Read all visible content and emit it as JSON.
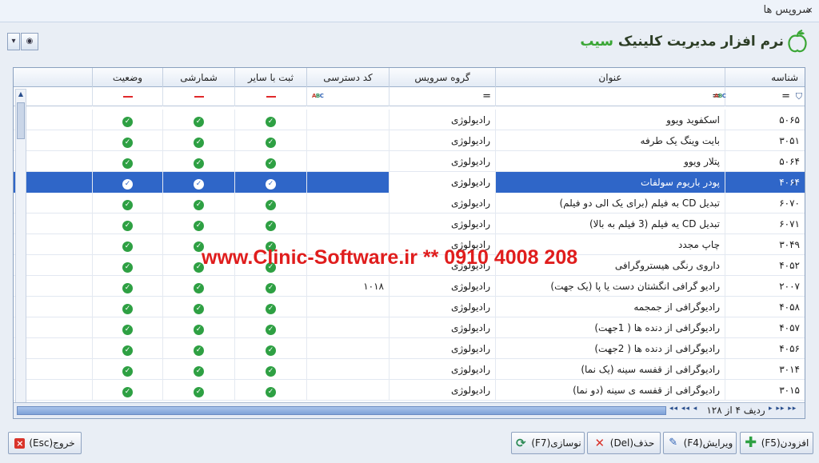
{
  "window": {
    "title": "سرویس ها",
    "minimize": "_",
    "close": "×"
  },
  "logo": {
    "prefix": "نرم افزار مدیریت کلینیک ",
    "accent": "سیب"
  },
  "grid": {
    "columns": [
      "شناسه",
      "عنوان",
      "گروه سرویس",
      "کد دسترسی",
      "ثبت با سایر",
      "شمارشی",
      "وضعیت"
    ],
    "filter_eq": "=",
    "filter_abc": "ABC",
    "rows": [
      {
        "id": "۵۰۶۵",
        "title": "اسکفوید ویوو",
        "group": "رادیولوژی",
        "code": ""
      },
      {
        "id": "۳۰۵۱",
        "title": "بایت وینگ یک طرفه",
        "group": "رادیولوژی",
        "code": ""
      },
      {
        "id": "۵۰۶۴",
        "title": "پتلار ویوو",
        "group": "رادیولوژی",
        "code": ""
      },
      {
        "id": "۴۰۶۴",
        "title": "پودر باریوم سولفات",
        "group": "رادیولوژی",
        "code": ""
      },
      {
        "id": "۶۰۷۰",
        "title": "تبدیل CD به فیلم (برای یک الی دو فیلم)",
        "group": "رادیولوژی",
        "code": ""
      },
      {
        "id": "۶۰۷۱",
        "title": "تبدیل CD یه فیلم (3 فیلم به بالا)",
        "group": "رادیولوژی",
        "code": ""
      },
      {
        "id": "۳۰۴۹",
        "title": "چاپ مجدد",
        "group": "رادیولوژی",
        "code": ""
      },
      {
        "id": "۴۰۵۲",
        "title": "داروی رنگی هیستروگرافی",
        "group": "رادیولوژی",
        "code": ""
      },
      {
        "id": "۲۰۰۷",
        "title": "رادیو گرافی انگشتان دست یا پا (یک جهت)",
        "group": "رادیولوژی",
        "code": "۱۰۱۸"
      },
      {
        "id": "۴۰۵۸",
        "title": "رادیوگرافی از جمجمه",
        "group": "رادیولوژی",
        "code": ""
      },
      {
        "id": "۴۰۵۷",
        "title": "رادیوگرافی از دنده ها ( 1جهت)",
        "group": "رادیولوژی",
        "code": ""
      },
      {
        "id": "۴۰۵۶",
        "title": "رادیوگرافی از دنده ها ( 2جهت)",
        "group": "رادیولوژی",
        "code": ""
      },
      {
        "id": "۳۰۱۴",
        "title": "رادیوگرافی از قفسه سینه (یک نما)",
        "group": "رادیولوژی",
        "code": ""
      },
      {
        "id": "۳۰۱۵",
        "title": "رادیوگرافی از قفسه ی سینه (دو نما)",
        "group": "رادیولوژی",
        "code": ""
      }
    ],
    "selected_row": 3,
    "record_info": "ردیف ۴ از ۱۲۸"
  },
  "watermark": "www.Clinic-Software.ir  ** 0910 4008 208",
  "buttons": {
    "exit": "خروج(Esc)",
    "refresh": "نوسازی(F7)",
    "delete": "حذف(Del)",
    "edit": "ویرایش(F4)",
    "add": "افزودن(F5)"
  },
  "colors": {
    "selection": "#2f66c8",
    "check": "#2ea043",
    "watermark": "#e01d1d"
  }
}
